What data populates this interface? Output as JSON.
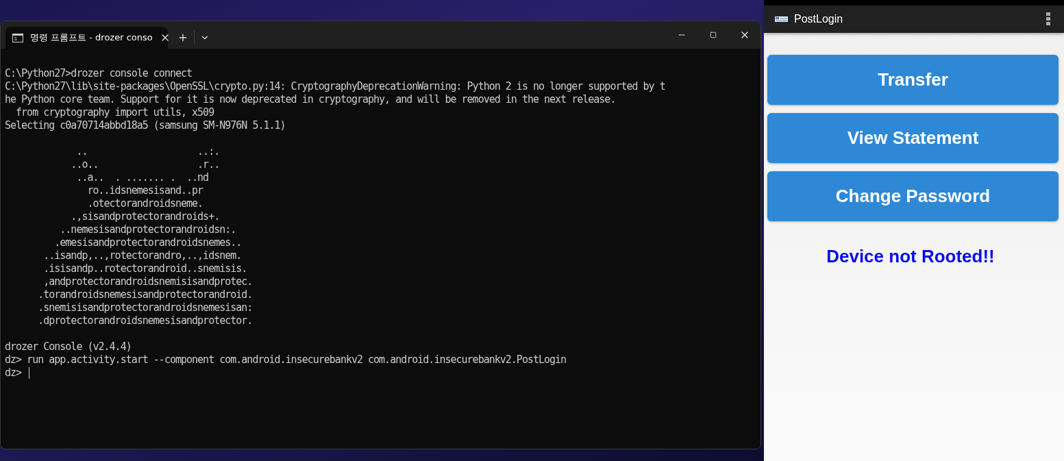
{
  "terminal": {
    "tab": {
      "title": "명령 프롬프트 - drozer  conso",
      "selected": true
    },
    "blocks": [
      [
        "C:\\Python27>drozer console connect",
        "C:\\Python27\\lib\\site-packages\\OpenSSL\\crypto.py:14: CryptographyDeprecationWarning: Python 2 is no longer supported by t",
        "he Python core team. Support for it is now deprecated in cryptography, and will be removed in the next release.",
        "  from cryptography import utils, x509",
        "Selecting c0a70714abbd18a5 (samsung SM-N976N 5.1.1)"
      ],
      [
        "             ..                    ..:.",
        "            ..o..                  .r..",
        "             ..a..  . ....... .  ..nd",
        "               ro..idsnemesisand..pr",
        "               .otectorandroidsneme.",
        "            .,sisandprotectorandroids+.",
        "          ..nemesisandprotectorandroidsn:.",
        "         .emesisandprotectorandroidsnemes..",
        "       ..isandp,..,rotectorandro,..,idsnem.",
        "       .isisandp..rotectorandroid..snemisis.",
        "       ,andprotectorandroidsnemisisandprotec.",
        "      .torandroidsnemesisandprotectorandroid.",
        "      .snemisisandprotectorandroidsnemesisan:",
        "      .dprotectorandroidsnemesisandprotector."
      ],
      [
        "drozer Console (v2.4.4)",
        "dz> run app.activity.start --component com.android.insecurebankv2 com.android.insecurebankv2.PostLogin"
      ]
    ],
    "prompt": "dz>"
  },
  "phone": {
    "title": "PostLogin",
    "buttons": [
      "Transfer",
      "View Statement",
      "Change Password"
    ],
    "status": "Device not Rooted!!"
  }
}
